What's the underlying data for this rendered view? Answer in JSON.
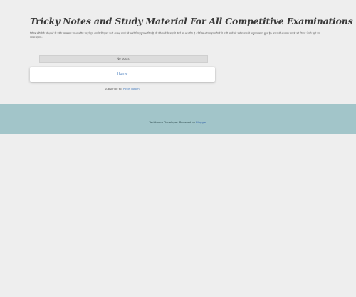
{
  "header": {
    "title": "Tricky Notes and Study Material For All Competitive Examinations",
    "description": "विभिन्न प्रतियोगी परीक्षाओं के नवीन पाठ्यक्रम पर आधारित नए नोट्स आपके लिए उन सभी अध्यक्ष छात्रों को अपने लिए मूल्य शामिल है जो परीक्षाओं के बदलते पैटर्न पर आधारित है । विभिन्न ऑनलाइन तरीकों से सभी छात्रों को पर्याप्त रूप से अनुरूप प्रदान हुआ है । उन सभी अध्ययन सामग्री को निरंतर भेजते रहने का प्रयास रहेगा ।"
  },
  "main": {
    "no_posts_label": "No posts.",
    "home_link": "Home",
    "subscribe_prefix": "Subscribe to: ",
    "subscribe_link": "Posts (Atom)"
  },
  "footer": {
    "text_prefix": "TechHome Developer. Powered by ",
    "powered_link": "Blogger."
  },
  "colors": {
    "background": "#eeeeee",
    "footer_band": "#a2c5c9",
    "link": "#4a7fbf"
  }
}
